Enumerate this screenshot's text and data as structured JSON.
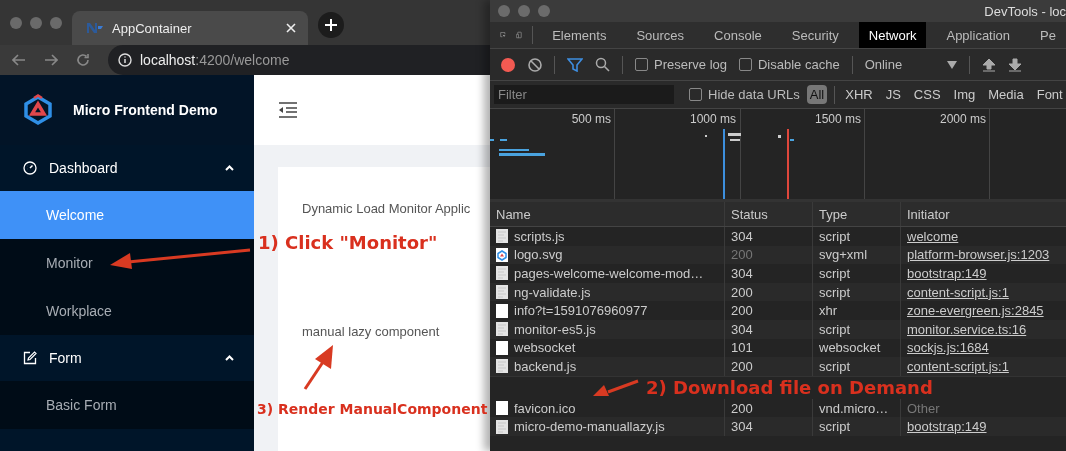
{
  "browser": {
    "tab_title": "AppContainer",
    "url_host": "localhost",
    "url_path": ":4200/welcome"
  },
  "app": {
    "title": "Micro Frontend Demo",
    "menu": [
      {
        "label": "Dashboard",
        "expanded": true,
        "children": [
          {
            "label": "Welcome",
            "selected": true
          },
          {
            "label": "Monitor",
            "selected": false
          },
          {
            "label": "Workplace",
            "selected": false
          }
        ]
      },
      {
        "label": "Form",
        "expanded": true,
        "children": [
          {
            "label": "Basic Form",
            "selected": false
          }
        ]
      }
    ],
    "card_texts": [
      "Dynamic Load Monitor Applic",
      "manual lazy component"
    ]
  },
  "devtools": {
    "title": "DevTools - loc",
    "tabs": [
      {
        "label": "Elements",
        "selected": false
      },
      {
        "label": "Sources",
        "selected": false
      },
      {
        "label": "Console",
        "selected": false
      },
      {
        "label": "Security",
        "selected": false
      },
      {
        "label": "Network",
        "selected": true
      },
      {
        "label": "Application",
        "selected": false
      },
      {
        "label": "Pe",
        "selected": false
      }
    ],
    "recording": true,
    "options": [
      {
        "label": "Preserve log",
        "checked": false
      },
      {
        "label": "Disable cache",
        "checked": false
      }
    ],
    "throttle": "Online",
    "filter": {
      "placeholder": "Filter",
      "hide_data_urls": {
        "label": "Hide data URLs",
        "checked": false
      }
    },
    "types": [
      {
        "label": "All",
        "selected": true
      },
      {
        "label": "XHR",
        "selected": false
      },
      {
        "label": "JS",
        "selected": false
      },
      {
        "label": "CSS",
        "selected": false
      },
      {
        "label": "Img",
        "selected": false
      },
      {
        "label": "Media",
        "selected": false
      },
      {
        "label": "Font",
        "selected": false
      }
    ],
    "timeline_ticks": [
      "500 ms",
      "1000 ms",
      "1500 ms",
      "2000 ms"
    ],
    "table": {
      "columns": [
        "Name",
        "Status",
        "Type",
        "Initiator"
      ],
      "rows": [
        {
          "kind": "script",
          "name": "scripts.js",
          "status": "304",
          "status_dimmed": false,
          "type": "script",
          "initiator": "welcome",
          "initiator_link": true
        },
        {
          "kind": "image",
          "name": "logo.svg",
          "status": "200",
          "status_dimmed": true,
          "type": "svg+xml",
          "initiator": "platform-browser.js:1203",
          "initiator_link": true
        },
        {
          "kind": "script",
          "name": "pages-welcome-welcome-mod…",
          "status": "304",
          "status_dimmed": false,
          "type": "script",
          "initiator": "bootstrap:149",
          "initiator_link": true
        },
        {
          "kind": "script",
          "name": "ng-validate.js",
          "status": "200",
          "status_dimmed": false,
          "type": "script",
          "initiator": "content-script.js:1",
          "initiator_link": true
        },
        {
          "kind": "plain",
          "name": "info?t=1591076960977",
          "status": "200",
          "status_dimmed": false,
          "type": "xhr",
          "initiator": "zone-evergreen.js:2845",
          "initiator_link": true
        },
        {
          "kind": "script",
          "name": "monitor-es5.js",
          "status": "304",
          "status_dimmed": false,
          "type": "script",
          "initiator": "monitor.service.ts:16",
          "initiator_link": true
        },
        {
          "kind": "plain",
          "name": "websocket",
          "status": "101",
          "status_dimmed": false,
          "type": "websocket",
          "initiator": "sockjs.js:1684",
          "initiator_link": true
        },
        {
          "kind": "script",
          "name": "backend.js",
          "status": "200",
          "status_dimmed": false,
          "type": "script",
          "initiator": "content-script.js:1",
          "initiator_link": true
        },
        {
          "kind": "plain",
          "name": "favicon.ico",
          "status": "200",
          "status_dimmed": false,
          "type": "vnd.micro…",
          "initiator": "Other",
          "initiator_link": false
        },
        {
          "kind": "script",
          "name": "micro-demo-manuallazy.js",
          "status": "304",
          "status_dimmed": false,
          "type": "script",
          "initiator": "bootstrap:149",
          "initiator_link": true
        }
      ]
    }
  },
  "annotations": [
    {
      "text": "1) Click \"Monitor\""
    },
    {
      "text": "3) Render ManualComponent"
    },
    {
      "text": "2) Download file on Demand"
    }
  ]
}
